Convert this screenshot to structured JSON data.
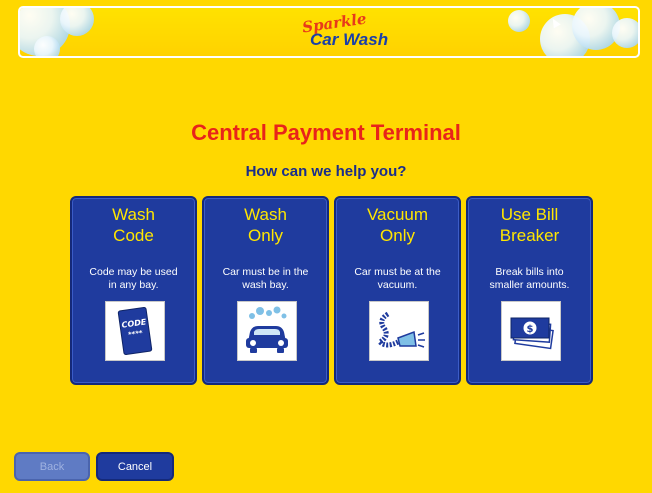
{
  "header": {
    "logo_brand": "Sparkle",
    "logo_name": "Car Wash"
  },
  "page": {
    "title": "Central Payment Terminal",
    "subtitle": "How can we help you?"
  },
  "options": [
    {
      "title": "Wash\nCode",
      "description": "Code may be used\nin any bay.",
      "icon": "code-card-icon",
      "icon_text": "CODE",
      "icon_stars": "****"
    },
    {
      "title": "Wash\nOnly",
      "description": "Car must be in the\nwash bay.",
      "icon": "car-wash-icon"
    },
    {
      "title": "Vacuum\nOnly",
      "description": "Car must be at the\nvacuum.",
      "icon": "vacuum-hose-icon"
    },
    {
      "title": "Use Bill\nBreaker",
      "description": "Break bills into\nsmaller amounts.",
      "icon": "money-bills-icon"
    }
  ],
  "footer": {
    "back_label": "Back",
    "cancel_label": "Cancel"
  },
  "colors": {
    "background": "#ffd800",
    "button_blue": "#1f3b9e",
    "title_red": "#e8241a",
    "option_title_yellow": "#ffe600"
  }
}
